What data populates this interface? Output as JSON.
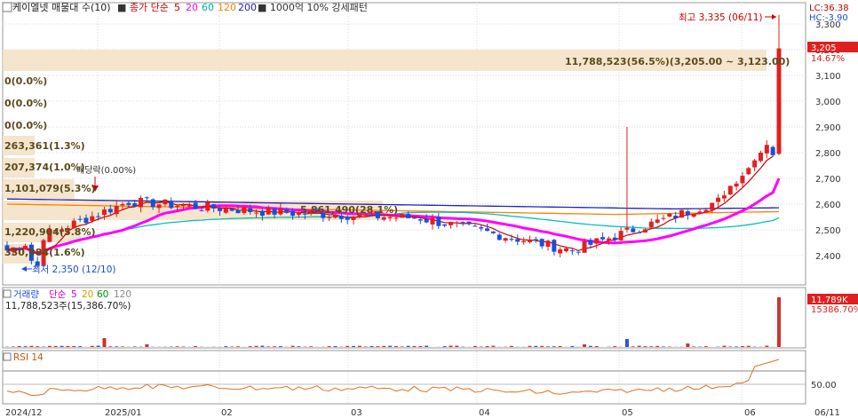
{
  "header": {
    "checkbox_label": "케이엘넷 매물대 수(10)",
    "legend_close": "종가 단순",
    "ma_periods": [
      "5",
      "20",
      "60",
      "120",
      "200"
    ],
    "filter_label": "1000억 10% 강세패턴"
  },
  "colors": {
    "up": "#e02020",
    "down": "#1a4fd8",
    "ma5": "#cc0000",
    "ma20": "#ff00ff",
    "ma60": "#00c0c0",
    "ma120": "#ff8000",
    "ma200": "#2222bb",
    "bg_header": "#f5f5f5"
  },
  "price_axis": {
    "ticks": [
      "3,300",
      "3,200",
      "3,100",
      "3,000",
      "2,900",
      "2,800",
      "2,700",
      "2,600",
      "2,500",
      "2,400"
    ],
    "current_price": "3,205",
    "current_pct": "14.67%",
    "lc": "LC:36.38",
    "hc": "HC:-3.90"
  },
  "annotations": {
    "high": "최고 3,335 (06/11)",
    "low": "최저 2,350 (12/10)",
    "ex_dividend": "배당락(0.00%)"
  },
  "volume_profile": {
    "top_band_label": "11,788,523(56.5%)(3,205.00 ~ 3,123.00)",
    "labels": [
      "0(0.0%)",
      "0(0.0%)",
      "0(0.0%)",
      "263,361(1.3%)",
      "207,374(1.0%)",
      "1,101,079(5.3%)",
      "5,861,490(28.1%)",
      "1,220,904(5.8%)",
      "330,984(1.6%)"
    ],
    "bar_pcts": [
      56.5,
      0.0,
      0.0,
      0.0,
      1.3,
      1.0,
      5.3,
      28.1,
      5.8,
      1.6
    ]
  },
  "volume_panel": {
    "legend_title": "거래량",
    "legend_ma": "단순",
    "ma_periods": [
      "5",
      "20",
      "60",
      "120"
    ],
    "info_line": "11,788,523주(15,386.70%)",
    "right_value": "11,789K",
    "right_pct": "15386.70%"
  },
  "rsi_panel": {
    "legend": "RSI 14",
    "tick": "50.00"
  },
  "date_axis": {
    "labels": [
      "2024/12",
      "2025/01",
      "02",
      "03",
      "04",
      "05",
      "06"
    ],
    "right_label": "06/11"
  },
  "chart_data": {
    "type": "candlestick",
    "y_range": [
      2350,
      3335
    ],
    "high": 3335,
    "low": 2350,
    "last_close": 3205,
    "pct_change": 14.67,
    "last_volume": 11788523,
    "anchors": [
      {
        "month": "2024/12",
        "approx_close": 2420
      },
      {
        "month": "2025/01",
        "approx_close": 2600
      },
      {
        "month": "02",
        "approx_close": 2570
      },
      {
        "month": "03",
        "approx_close": 2540
      },
      {
        "month": "04",
        "approx_close": 2420
      },
      {
        "month": "05",
        "approx_close": 2610
      },
      {
        "month": "06",
        "approx_close": 2800
      }
    ]
  }
}
